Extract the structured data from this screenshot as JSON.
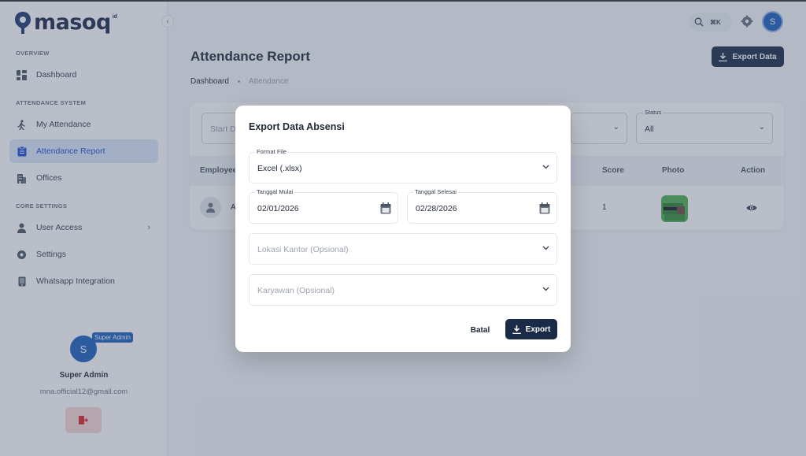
{
  "app": {
    "logo_text": "masoq",
    "logo_sup": "id"
  },
  "sidebar": {
    "sections": [
      {
        "label": "OVERVIEW"
      },
      {
        "label": "ATTENDANCE SYSTEM"
      },
      {
        "label": "CORE SETTINGS"
      }
    ],
    "items": [
      {
        "label": "Dashboard",
        "icon": "dashboard-icon"
      },
      {
        "label": "My Attendance",
        "icon": "person-walking-icon"
      },
      {
        "label": "Attendance Report",
        "icon": "report-icon",
        "active": true
      },
      {
        "label": "Offices",
        "icon": "building-icon"
      },
      {
        "label": "User Access",
        "icon": "user-icon"
      },
      {
        "label": "Settings",
        "icon": "gear-icon"
      },
      {
        "label": "Whatsapp Integration",
        "icon": "phone-icon"
      }
    ],
    "profile": {
      "initial": "S",
      "badge": "Super Admin",
      "name": "Super Admin",
      "email": "mna.official12@gmail.com"
    }
  },
  "topbar": {
    "search_shortcut": "⌘K",
    "avatar_initial": "S"
  },
  "page": {
    "title": "Attendance Report",
    "export_label": "Export Data",
    "breadcrumb": {
      "home": "Dashboard",
      "current": "Attendance"
    }
  },
  "filters": {
    "start_placeholder": "Start D",
    "status": {
      "label": "Status",
      "value": "All"
    }
  },
  "table": {
    "headers": {
      "employee": "Employee",
      "score": "Score",
      "photo": "Photo",
      "action": "Action"
    },
    "rows": [
      {
        "name_initial": "A",
        "score": "1"
      }
    ]
  },
  "modal": {
    "title": "Export Data Absensi",
    "format": {
      "label": "Format File",
      "value": "Excel (.xlsx)"
    },
    "start_date": {
      "label": "Tanggal Mulai",
      "value": "02/01/2026"
    },
    "end_date": {
      "label": "Tanggal Selesai",
      "value": "02/28/2026"
    },
    "office": {
      "placeholder": "Lokasi Kantor (Opsional)"
    },
    "employee": {
      "placeholder": "Karyawan (Opsional)"
    },
    "cancel_label": "Batal",
    "export_label": "Export"
  },
  "colors": {
    "primary_dark": "#1a2b47",
    "accent_blue": "#1d5fbf",
    "active_bg": "#dbe7f8"
  }
}
